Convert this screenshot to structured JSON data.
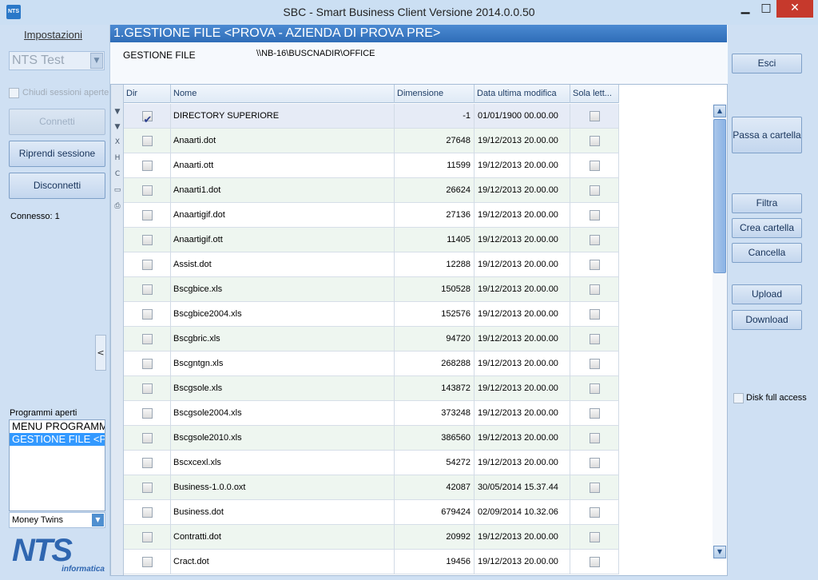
{
  "window": {
    "title": "SBC - Smart Business Client  Versione 2014.0.0.50",
    "icon_text": "NTS"
  },
  "sidebar": {
    "settings_link": "Impostazioni",
    "company": "NTS Test",
    "close_sessions_label": "Chiudi sessioni aperte",
    "connect_label": "Connetti",
    "resume_label": "Riprendi sessione",
    "disconnect_label": "Disconnetti",
    "status": "Connesso: 1",
    "collapse_label": "<",
    "open_programs_label": "Programmi aperti",
    "open_programs": [
      "MENU PROGRAMMI",
      "GESTIONE FILE <PROVA"
    ],
    "module": "Money Twins",
    "logo_big": "NTS",
    "logo_small": "informatica"
  },
  "main": {
    "header": "1.GESTIONE FILE <PROVA - AZIENDA DI PROVA PRE>",
    "path_label": "GESTIONE FILE",
    "path_value": "\\\\NB-16\\BUSCNADIR\\OFFICE",
    "columns": [
      "Dir",
      "Nome",
      "Dimensione",
      "Data ultima modifica",
      "Sola lett..."
    ],
    "rows": [
      {
        "dir": true,
        "name": "DIRECTORY SUPERIORE",
        "size": "-1",
        "date": "01/01/1900 00.00.00",
        "ro": false
      },
      {
        "dir": false,
        "name": "Anaarti.dot",
        "size": "27648",
        "date": "19/12/2013 20.00.00",
        "ro": false
      },
      {
        "dir": false,
        "name": "Anaarti.ott",
        "size": "11599",
        "date": "19/12/2013 20.00.00",
        "ro": false
      },
      {
        "dir": false,
        "name": "Anaarti1.dot",
        "size": "26624",
        "date": "19/12/2013 20.00.00",
        "ro": false
      },
      {
        "dir": false,
        "name": "Anaartigif.dot",
        "size": "27136",
        "date": "19/12/2013 20.00.00",
        "ro": false
      },
      {
        "dir": false,
        "name": "Anaartigif.ott",
        "size": "11405",
        "date": "19/12/2013 20.00.00",
        "ro": false
      },
      {
        "dir": false,
        "name": "Assist.dot",
        "size": "12288",
        "date": "19/12/2013 20.00.00",
        "ro": false
      },
      {
        "dir": false,
        "name": "Bscgbice.xls",
        "size": "150528",
        "date": "19/12/2013 20.00.00",
        "ro": false
      },
      {
        "dir": false,
        "name": "Bscgbice2004.xls",
        "size": "152576",
        "date": "19/12/2013 20.00.00",
        "ro": false
      },
      {
        "dir": false,
        "name": "Bscgbric.xls",
        "size": "94720",
        "date": "19/12/2013 20.00.00",
        "ro": false
      },
      {
        "dir": false,
        "name": "Bscgntgn.xls",
        "size": "268288",
        "date": "19/12/2013 20.00.00",
        "ro": false
      },
      {
        "dir": false,
        "name": "Bscgsole.xls",
        "size": "143872",
        "date": "19/12/2013 20.00.00",
        "ro": false
      },
      {
        "dir": false,
        "name": "Bscgsole2004.xls",
        "size": "373248",
        "date": "19/12/2013 20.00.00",
        "ro": false
      },
      {
        "dir": false,
        "name": "Bscgsole2010.xls",
        "size": "386560",
        "date": "19/12/2013 20.00.00",
        "ro": false
      },
      {
        "dir": false,
        "name": "Bscxcexl.xls",
        "size": "54272",
        "date": "19/12/2013 20.00.00",
        "ro": false
      },
      {
        "dir": false,
        "name": "Business-1.0.0.oxt",
        "size": "42087",
        "date": "30/05/2014 15.37.44",
        "ro": false
      },
      {
        "dir": false,
        "name": "Business.dot",
        "size": "679424",
        "date": "02/09/2014 10.32.06",
        "ro": false
      },
      {
        "dir": false,
        "name": "Contratti.dot",
        "size": "20992",
        "date": "19/12/2013 20.00.00",
        "ro": false
      },
      {
        "dir": false,
        "name": "Cract.dot",
        "size": "19456",
        "date": "19/12/2013 20.00.00",
        "ro": false
      }
    ]
  },
  "actions": {
    "exit": "Esci",
    "goto_folder": "Passa a cartella",
    "filter": "Filtra",
    "create_folder": "Crea cartella",
    "delete": "Cancella",
    "upload": "Upload",
    "download": "Download",
    "disk_full_access": "Disk full access"
  }
}
